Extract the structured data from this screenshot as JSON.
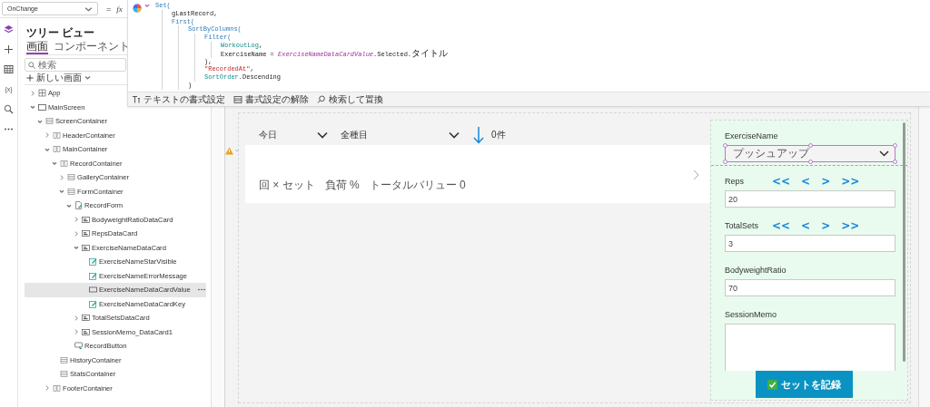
{
  "property_bar": {
    "property": "OnChange",
    "equals": "=",
    "fx": "fx"
  },
  "rail": [
    {
      "kind": "tree",
      "selected": true
    },
    {
      "kind": "insert",
      "selected": false
    },
    {
      "kind": "data",
      "selected": false
    },
    {
      "kind": "variables",
      "label": "{x}",
      "selected": false
    },
    {
      "kind": "search",
      "selected": false
    },
    {
      "kind": "more",
      "selected": false
    }
  ],
  "tree_view": {
    "title": "ツリー ビュー",
    "tabs": [
      {
        "label": "画面",
        "selected": true
      },
      {
        "label": "コンポーネント",
        "selected": false
      }
    ],
    "search": {
      "placeholder": "検索"
    },
    "new_screen": "新しい画面",
    "items": [
      {
        "label": "App",
        "kind": "app",
        "expanded": false,
        "selected": false
      },
      {
        "label": "MainScreen",
        "kind": "screen",
        "expanded": true,
        "selected": false,
        "children": [
          {
            "label": "ScreenContainer",
            "kind": "vertical-container",
            "expanded": true,
            "selected": false,
            "children": [
              {
                "label": "HeaderContainer",
                "kind": "horizontal-container",
                "expanded": false,
                "selected": false
              },
              {
                "label": "MainContainer",
                "kind": "horizontal-container",
                "expanded": true,
                "selected": false,
                "children": [
                  {
                    "label": "RecordContainer",
                    "kind": "horizontal-container",
                    "expanded": true,
                    "selected": false,
                    "children": [
                      {
                        "label": "GalleryContainer",
                        "kind": "vertical-container",
                        "expanded": false,
                        "selected": false
                      },
                      {
                        "label": "FormContainer",
                        "kind": "vertical-container",
                        "expanded": true,
                        "selected": false,
                        "children": [
                          {
                            "label": "RecordForm",
                            "kind": "form",
                            "expanded": true,
                            "selected": false,
                            "children": [
                              {
                                "label": "BodyweightRatioDataCard",
                                "kind": "data-card",
                                "expanded": false,
                                "selected": false
                              },
                              {
                                "label": "RepsDataCard",
                                "kind": "data-card",
                                "expanded": false,
                                "selected": false
                              },
                              {
                                "label": "ExerciseNameDataCard",
                                "kind": "data-card",
                                "expanded": true,
                                "selected": false,
                                "children": [
                                  {
                                    "label": "ExerciseNameStarVisible",
                                    "kind": "label",
                                    "selected": false
                                  },
                                  {
                                    "label": "ExerciseNameErrorMessage",
                                    "kind": "label",
                                    "selected": false
                                  },
                                  {
                                    "label": "ExerciseNameDataCardValue",
                                    "kind": "combobox",
                                    "selected": true
                                  },
                                  {
                                    "label": "ExerciseNameDataCardKey",
                                    "kind": "label",
                                    "selected": false
                                  }
                                ]
                              },
                              {
                                "label": "TotalSetsDataCard",
                                "kind": "data-card",
                                "expanded": false,
                                "selected": false
                              },
                              {
                                "label": "SessionMemo_DataCard1",
                                "kind": "data-card",
                                "expanded": false,
                                "selected": false
                              }
                            ]
                          },
                          {
                            "label": "RecordButton",
                            "kind": "button",
                            "selected": false
                          }
                        ]
                      }
                    ]
                  },
                  {
                    "label": "HistoryContainer",
                    "kind": "vertical-container",
                    "selected": false
                  },
                  {
                    "label": "StatsContainer",
                    "kind": "vertical-container",
                    "selected": false
                  }
                ]
              },
              {
                "label": "FooterContainer",
                "kind": "horizontal-container",
                "expanded": false,
                "selected": false
              }
            ]
          }
        ]
      }
    ]
  },
  "formula_editor": {
    "code": [
      {
        "tokens": [
          {
            "text": "Set(",
            "kind": "function"
          }
        ],
        "children": [
          {
            "tokens": [
              {
                "text": "gLastRecord,",
                "kind": "variable"
              }
            ]
          },
          {
            "tokens": [
              {
                "text": "First(",
                "kind": "function"
              }
            ],
            "children": [
              {
                "tokens": [
                  {
                    "text": "SortByColumns(",
                    "kind": "function"
                  }
                ],
                "children": [
                  {
                    "tokens": [
                      {
                        "text": "Filter(",
                        "kind": "function"
                      }
                    ],
                    "children": [
                      {
                        "tokens": [
                          {
                            "text": "WorkoutLog",
                            "kind": "datasource"
                          },
                          {
                            "text": ",",
                            "kind": "plain"
                          }
                        ]
                      },
                      {
                        "tokens": [
                          {
                            "text": "ExerciseName = ",
                            "kind": "plain"
                          },
                          {
                            "text": "ExerciseNameDataCardValue",
                            "kind": "control"
                          },
                          {
                            "text": ".Selected.",
                            "kind": "plain"
                          },
                          {
                            "text": "タイトル",
                            "kind": "plain"
                          }
                        ]
                      }
                    ]
                  },
                  {
                    "tokens": [
                      {
                        "text": "),",
                        "kind": "plain"
                      }
                    ]
                  },
                  {
                    "tokens": [
                      {
                        "text": "\"RecordedAt\"",
                        "kind": "string"
                      },
                      {
                        "text": ",",
                        "kind": "plain"
                      }
                    ]
                  },
                  {
                    "tokens": [
                      {
                        "text": "SortOrder",
                        "kind": "datasource"
                      },
                      {
                        "text": ".Descending",
                        "kind": "plain"
                      }
                    ]
                  }
                ]
              },
              {
                "tokens": [
                  {
                    "text": ")",
                    "kind": "plain"
                  }
                ]
              }
            ]
          }
        ]
      }
    ],
    "toolbar": [
      {
        "kind": "format",
        "label": "テキストの書式設定"
      },
      {
        "kind": "clear",
        "label": "書式設定の解除"
      },
      {
        "kind": "find",
        "label": "検索して置換"
      }
    ]
  },
  "canvas": {
    "filters": [
      {
        "label": "今日"
      },
      {
        "label": "全種目"
      }
    ],
    "count": "0件",
    "gallery_item": {
      "summary": [
        "回 × セット",
        "負荷 %",
        "トータルバリュー 0"
      ]
    },
    "warning": true,
    "form": {
      "fields": [
        {
          "label": "ExerciseName",
          "kind": "dropdown",
          "value": "プッシュアップ",
          "selected": true
        },
        {
          "label": "Reps",
          "kind": "number",
          "value": "20",
          "steppers": [
            "<<",
            "<",
            ">",
            ">>"
          ],
          "selected": false
        },
        {
          "label": "TotalSets",
          "kind": "number",
          "value": "3",
          "steppers": [
            "<<",
            "<",
            ">",
            ">>"
          ],
          "selected": false
        },
        {
          "label": "BodyweightRatio",
          "kind": "number",
          "value": "70",
          "selected": false
        },
        {
          "label": "SessionMemo",
          "kind": "multiline",
          "selected": false
        }
      ],
      "button": "セットを記録"
    }
  }
}
